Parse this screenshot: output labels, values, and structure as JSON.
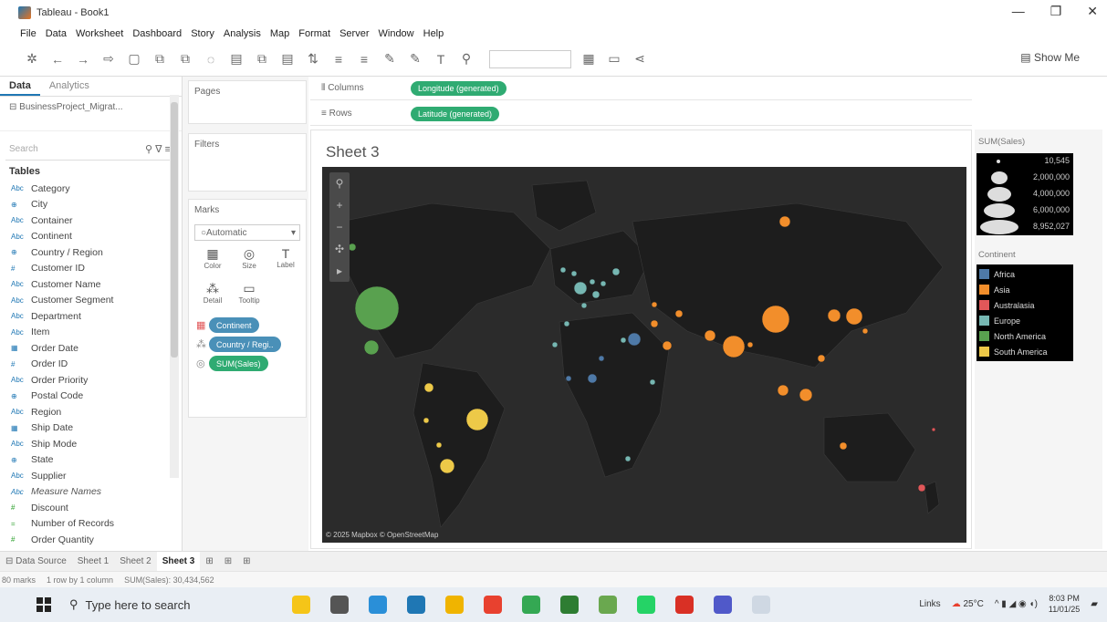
{
  "window": {
    "title": "Tableau - Book1",
    "controls": [
      "—",
      "❐",
      "✕"
    ]
  },
  "menu": [
    "File",
    "Data",
    "Worksheet",
    "Dashboard",
    "Story",
    "Analysis",
    "Map",
    "Format",
    "Server",
    "Window",
    "Help"
  ],
  "toolbar": {
    "show_me": "Show Me"
  },
  "left_pane": {
    "tabs": [
      "Data",
      "Analytics"
    ],
    "datasource": "BusinessProject_Migrat...",
    "search_placeholder": "Search",
    "tables_header": "Tables",
    "fields": [
      {
        "type": "Abc",
        "name": "Category"
      },
      {
        "type": "⊕",
        "name": "City"
      },
      {
        "type": "Abc",
        "name": "Container"
      },
      {
        "type": "Abc",
        "name": "Continent"
      },
      {
        "type": "⊕",
        "name": "Country / Region"
      },
      {
        "type": "#",
        "name": "Customer ID"
      },
      {
        "type": "Abc",
        "name": "Customer Name"
      },
      {
        "type": "Abc",
        "name": "Customer Segment"
      },
      {
        "type": "Abc",
        "name": "Department"
      },
      {
        "type": "Abc",
        "name": "Item"
      },
      {
        "type": "▦",
        "name": "Order Date"
      },
      {
        "type": "#",
        "name": "Order ID"
      },
      {
        "type": "Abc",
        "name": "Order Priority"
      },
      {
        "type": "⊕",
        "name": "Postal Code"
      },
      {
        "type": "Abc",
        "name": "Region"
      },
      {
        "type": "▦",
        "name": "Ship Date"
      },
      {
        "type": "Abc",
        "name": "Ship Mode"
      },
      {
        "type": "⊕",
        "name": "State"
      },
      {
        "type": "Abc",
        "name": "Supplier"
      },
      {
        "type": "Abc",
        "name": "Measure Names",
        "italic": true
      },
      {
        "type": "#",
        "name": "Discount",
        "measure": true
      },
      {
        "type": "=",
        "name": "Number of Records",
        "measure": true
      },
      {
        "type": "#",
        "name": "Order Quantity",
        "measure": true
      }
    ]
  },
  "cards": {
    "pages": "Pages",
    "filters": "Filters",
    "marks": "Marks",
    "marks_type": "Automatic",
    "mark_buttons": [
      {
        "icon": "▦",
        "label": "Color"
      },
      {
        "icon": "◎",
        "label": "Size"
      },
      {
        "icon": "T",
        "label": "Label"
      },
      {
        "icon": "⁂",
        "label": "Detail"
      },
      {
        "icon": "▭",
        "label": "Tooltip"
      }
    ],
    "pills": [
      {
        "icon": "▦",
        "label": "Continent",
        "color": "blue"
      },
      {
        "icon": "⁂",
        "label": "Country / Regi..",
        "color": "blue"
      },
      {
        "icon": "◎",
        "label": "SUM(Sales)",
        "color": "green"
      }
    ]
  },
  "shelves": {
    "columns_label": "Columns",
    "columns_pill": "Longitude (generated)",
    "rows_label": "Rows",
    "rows_pill": "Latitude (generated)"
  },
  "sheet": {
    "title": "Sheet 3",
    "credit": "© 2025 Mapbox © OpenStreetMap"
  },
  "legends": {
    "size_title": "SUM(Sales)",
    "size_items": [
      "10,545",
      "2,000,000",
      "4,000,000",
      "6,000,000",
      "8,952,027"
    ],
    "color_title": "Continent",
    "color_items": [
      {
        "name": "Africa",
        "color": "#4e79a7"
      },
      {
        "name": "Asia",
        "color": "#f28e2b"
      },
      {
        "name": "Australasia",
        "color": "#e15759"
      },
      {
        "name": "Europe",
        "color": "#76b7b2"
      },
      {
        "name": "North America",
        "color": "#59a14f"
      },
      {
        "name": "South America",
        "color": "#edc948"
      }
    ]
  },
  "sheet_tabs": [
    "Data Source",
    "Sheet 1",
    "Sheet 2",
    "Sheet 3"
  ],
  "status": {
    "marks": "80 marks",
    "rows": "1 row by 1 column",
    "sum": "SUM(Sales): 30,434,562"
  },
  "taskbar": {
    "search_placeholder": "Type here to search",
    "links": "Links",
    "weather": "25°C",
    "time": "8:03 PM",
    "date": "11/01/25"
  }
}
